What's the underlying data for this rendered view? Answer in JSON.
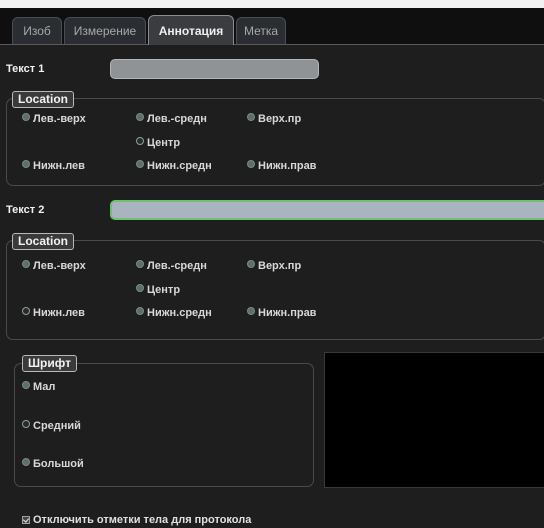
{
  "tabs": [
    {
      "label": "Изоб"
    },
    {
      "label": "Измерение"
    },
    {
      "label": "Аннотация",
      "active": true
    },
    {
      "label": "Метка"
    }
  ],
  "text1": {
    "label": "Текст 1",
    "value": ""
  },
  "location1": {
    "legend": "Location",
    "options": [
      "Лев.-верх",
      "Лев.-средн",
      "Верх.пр",
      "Центр",
      "Нижн.лев",
      "Нижн.средн",
      "Нижн.прав"
    ]
  },
  "text2": {
    "label": "Текст 2",
    "value": ""
  },
  "location2": {
    "legend": "Location",
    "options": [
      "Лев.-верх",
      "Лев.-средн",
      "Верх.пр",
      "Центр",
      "Нижн.лев",
      "Нижн.средн",
      "Нижн.прав"
    ]
  },
  "font": {
    "legend": "Шрифт",
    "options": [
      "Мал",
      "Средний",
      "Большой"
    ]
  },
  "protocol_checkbox": {
    "label": "Отключить отметки тела для протокола",
    "checked": true
  }
}
